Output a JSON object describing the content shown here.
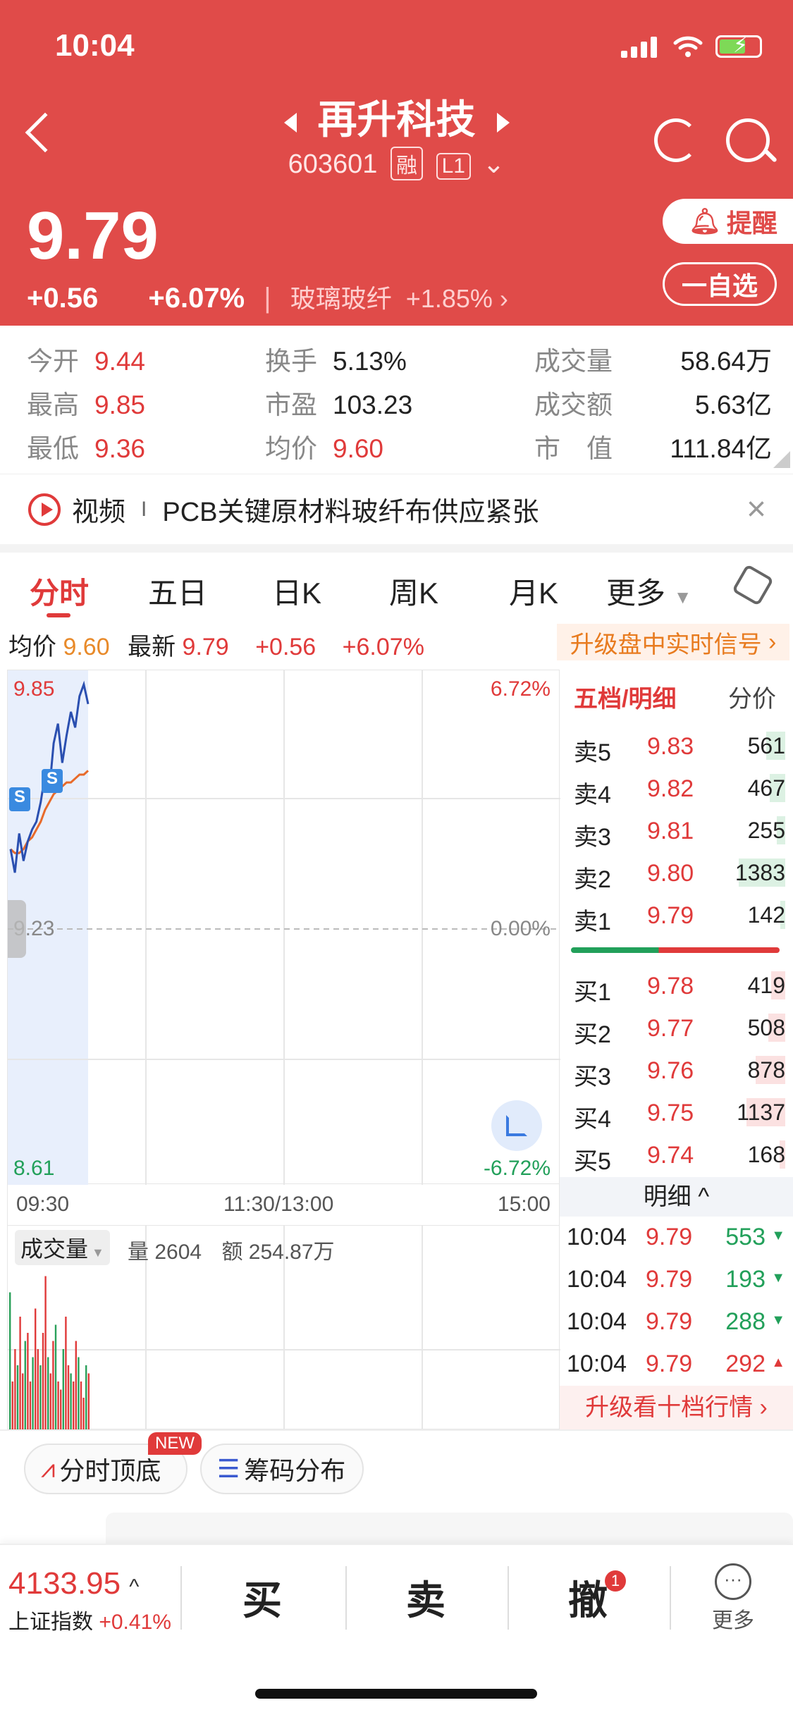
{
  "status_bar": {
    "time": "10:04"
  },
  "header": {
    "stock_name": "再升科技",
    "stock_code": "603601",
    "tag_margin": "融",
    "tag_level": "L1",
    "price": "9.79",
    "change": "+0.56",
    "change_pct": "+6.07%",
    "sector": "玻璃玻纤",
    "sector_pct": "+1.85%",
    "remind_label": "提醒",
    "fav_label": "一自选",
    "colors": {
      "bg": "#e04b49"
    }
  },
  "stats": {
    "open_label": "今开",
    "open": "9.44",
    "high_label": "最高",
    "high": "9.85",
    "low_label": "最低",
    "low": "9.36",
    "turnover_label": "换手",
    "turnover": "5.13%",
    "pe_label": "市盈",
    "pe": "103.23",
    "avg_label": "均价",
    "avg": "9.60",
    "volume_label": "成交量",
    "volume": "58.64万",
    "amount_label": "成交额",
    "amount": "5.63亿",
    "mktcap_label": "市　值",
    "mktcap": "111.84亿"
  },
  "news": {
    "type": "视频",
    "sep": "I",
    "text": "PCB关键原材料玻纤布供应紧张"
  },
  "tabs": [
    "分时",
    "五日",
    "日K",
    "周K",
    "月K",
    "更多"
  ],
  "quote_line": {
    "avg_label": "均价",
    "avg": "9.60",
    "latest_label": "最新",
    "latest": "9.79",
    "change": "+0.56",
    "change_pct": "+6.07%",
    "upgrade": "升级盘中实时信号"
  },
  "chart_data": {
    "type": "line",
    "y_max_label": "9.85",
    "y_mid_label": "9.23",
    "y_min_label": "8.61",
    "pct_max_label": "6.72%",
    "pct_mid_label": "0.00%",
    "pct_min_label": "-6.72%",
    "x_labels": [
      "09:30",
      "11:30/13:00",
      "15:00"
    ],
    "price_line": [
      9.43,
      9.37,
      9.47,
      9.4,
      9.45,
      9.48,
      9.5,
      9.55,
      9.62,
      9.58,
      9.7,
      9.75,
      9.65,
      9.72,
      9.78,
      9.74,
      9.82,
      9.85,
      9.8
    ],
    "avg_line": [
      9.43,
      9.42,
      9.42,
      9.43,
      9.45,
      9.46,
      9.48,
      9.5,
      9.53,
      9.55,
      9.57,
      9.58,
      9.59,
      9.6,
      9.6,
      9.61,
      9.62,
      9.62,
      9.63
    ],
    "signals": [
      "S",
      "S"
    ],
    "ylim": [
      8.61,
      9.85
    ]
  },
  "order_book": {
    "header": "五档/明细",
    "sub": "分价",
    "asks": [
      {
        "name": "卖5",
        "price": "9.83",
        "vol": "561"
      },
      {
        "name": "卖4",
        "price": "9.82",
        "vol": "467"
      },
      {
        "name": "卖3",
        "price": "9.81",
        "vol": "255"
      },
      {
        "name": "卖2",
        "price": "9.80",
        "vol": "1383"
      },
      {
        "name": "卖1",
        "price": "9.79",
        "vol": "142"
      }
    ],
    "bids": [
      {
        "name": "买1",
        "price": "9.78",
        "vol": "419"
      },
      {
        "name": "买2",
        "price": "9.77",
        "vol": "508"
      },
      {
        "name": "买3",
        "price": "9.76",
        "vol": "878"
      },
      {
        "name": "买4",
        "price": "9.75",
        "vol": "1137"
      },
      {
        "name": "买5",
        "price": "9.74",
        "vol": "168"
      }
    ],
    "detail_label": "明细",
    "ticks": [
      {
        "time": "10:04",
        "price": "9.79",
        "vol": "553",
        "dir": "down"
      },
      {
        "time": "10:04",
        "price": "9.79",
        "vol": "193",
        "dir": "down"
      },
      {
        "time": "10:04",
        "price": "9.79",
        "vol": "288",
        "dir": "down"
      },
      {
        "time": "10:04",
        "price": "9.79",
        "vol": "292",
        "dir": "up"
      }
    ],
    "upgrade": "升级看十档行情"
  },
  "volume": {
    "label": "成交量",
    "qty_label": "量",
    "qty": "2604",
    "amt_label": "额",
    "amt": "254.87万"
  },
  "tools": {
    "top_bottom": "分时顶底",
    "new_badge": "NEW",
    "chips": "筹码分布"
  },
  "bottom": {
    "index_value": "4133.95",
    "index_name": "上证指数",
    "index_pct": "+0.41%",
    "buy": "买",
    "sell": "卖",
    "cancel": "撤",
    "cancel_badge": "1",
    "more": "更多"
  }
}
